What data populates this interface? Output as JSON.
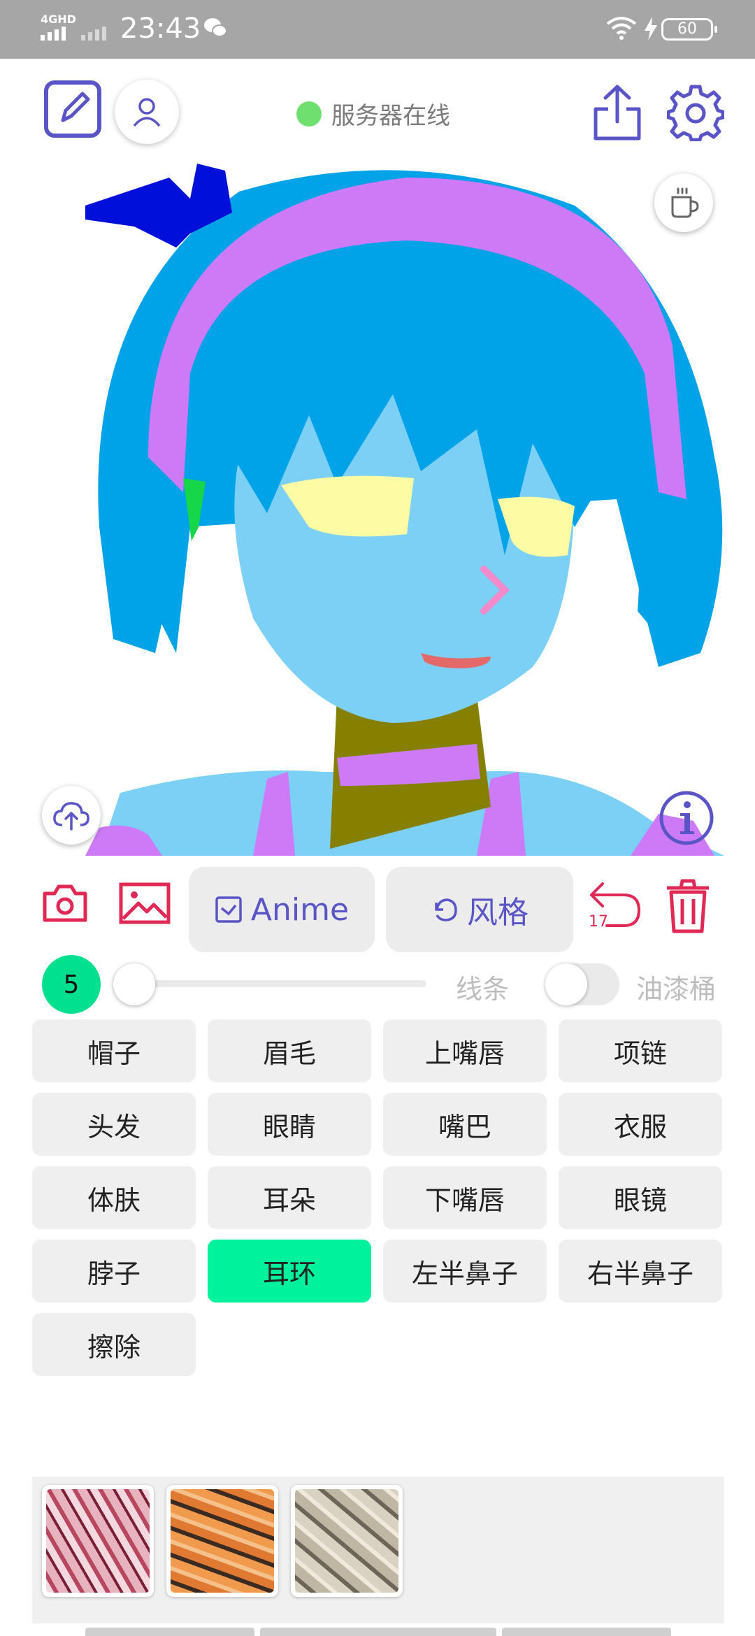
{
  "status_bar": {
    "network": "4GHD",
    "time": "23:43",
    "battery": "60"
  },
  "header": {
    "server_status": "服务器在线",
    "status_color": "#6fe06f"
  },
  "toolbar": {
    "anime_label": "Anime",
    "style_label": "风格",
    "undo_count": "17"
  },
  "brush": {
    "size": "5",
    "line_label": "线条",
    "bucket_label": "油漆桶",
    "bucket_enabled": false
  },
  "labels": {
    "items": [
      "帽子",
      "眉毛",
      "上嘴唇",
      "项链",
      "头发",
      "眼睛",
      "嘴巴",
      "衣服",
      "体肤",
      "耳朵",
      "下嘴唇",
      "眼镜",
      "脖子",
      "耳环",
      "左半鼻子",
      "右半鼻子",
      "擦除"
    ],
    "selected": "耳环"
  },
  "textures": [
    {
      "name": "texture-1",
      "color": "#c98596"
    },
    {
      "name": "texture-2",
      "color": "#d98a4a"
    },
    {
      "name": "texture-3",
      "color": "#a79e8c"
    }
  ],
  "colors": {
    "accent_purple": "#5a55c7",
    "accent_red": "#e02a55",
    "accent_green": "#00e08e",
    "hair": "#00a2e8",
    "skin": "#7dd0f5",
    "headband": "#cc7af5",
    "hat": "#0010d8",
    "eyes": "#fdfba4",
    "collar": "#858000"
  }
}
